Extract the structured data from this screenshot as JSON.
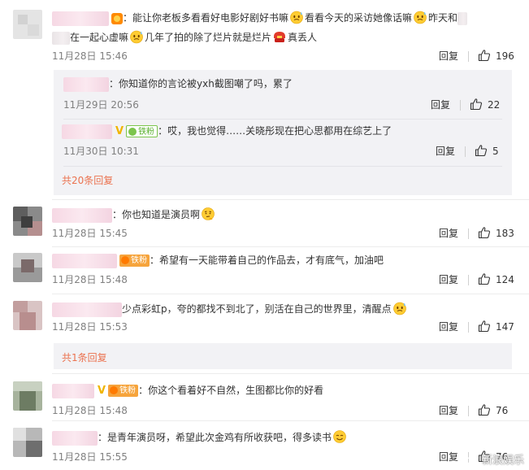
{
  "comments": [
    {
      "line1": "能让你老板多看看好电影好剧好书嘛",
      "line1b": "看看今天的采访她像话嘛",
      "line1c": "昨天和",
      "line2a": "在一起心虚嘛",
      "line2b": "几年了拍的除了烂片就是烂片",
      "line2c": "真丢人",
      "time": "11月28日 15:46",
      "reply_label": "回复",
      "likes": "196",
      "sub_replies": [
        {
          "text": "你知道你的言论被yxh截图嘲了吗，累了",
          "time": "11月29日 20:56",
          "reply_label": "回复",
          "likes": "22"
        },
        {
          "text": "哎，我也觉得……关晓彤现在把心思都用在综艺上了",
          "time": "11月30日 10:31",
          "reply_label": "回复",
          "likes": "5",
          "badge": "铁粉"
        }
      ],
      "more_label": "共20条回复"
    },
    {
      "text": "你也知道是演员啊",
      "time": "11月28日 15:45",
      "reply_label": "回复",
      "likes": "183"
    },
    {
      "text": "希望有一天能带着自己的作品去，才有底气，加油吧",
      "time": "11月28日 15:48",
      "reply_label": "回复",
      "likes": "124",
      "badge": "铁粉"
    },
    {
      "text": "少点彩虹p，夸的都找不到北了，别活在自己的世界里，清醒点",
      "time": "11月28日 15:53",
      "reply_label": "回复",
      "likes": "147",
      "more_label": "共1条回复"
    },
    {
      "text": "你这个看着好不自然，生图都比你的好看",
      "time": "11月28日 15:48",
      "reply_label": "回复",
      "likes": "76",
      "badge": "铁粉"
    },
    {
      "text": "是青年演员呀，希望此次金鸡有所收获吧，得多读书",
      "time": "11月28日 15:55",
      "reply_label": "回复",
      "likes": "76"
    }
  ],
  "watermark": "新浪娱乐",
  "colors": {
    "accent": "#eb7350",
    "time": "#808080",
    "subbox": "#f2f2f5"
  },
  "icons": [
    "thumb-up-icon",
    "vip-v-icon",
    "fan-badge-icon",
    "emoji-sweat-icon",
    "emoji-thinking-icon",
    "emoji-smile-icon"
  ]
}
